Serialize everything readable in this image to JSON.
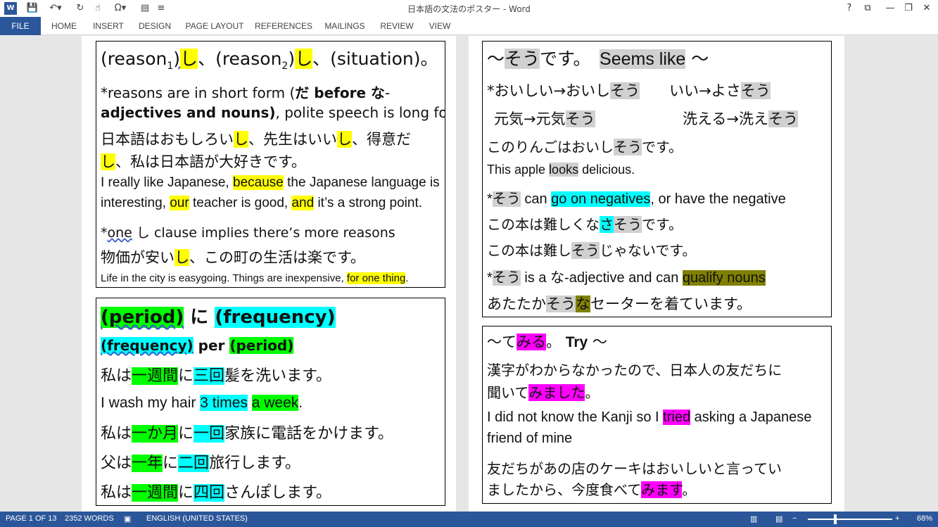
{
  "window": {
    "title": "日本語の文法のポスター - Word",
    "app_badge": "W",
    "controls": [
      "?",
      "⧉",
      "—",
      "❐",
      "✕"
    ]
  },
  "ribbon": {
    "tabs": [
      "FILE",
      "HOME",
      "INSERT",
      "DESIGN",
      "PAGE LAYOUT",
      "REFERENCES",
      "MAILINGS",
      "REVIEW",
      "VIEW"
    ]
  },
  "box1": {
    "l1": [
      "(reason",
      "1",
      ")",
      "し",
      "、(reason",
      "2",
      ")",
      "し",
      "、(situation)。"
    ],
    "l2": [
      "*reasons are in short form (",
      "だ before な",
      "-"
    ],
    "l3": [
      "adjectives and nouns)",
      ", polite speech is long form"
    ],
    "l4": [
      "日本語はおもしろい",
      "し",
      "、先生はいい",
      "し",
      "、得意だ"
    ],
    "l5": [
      "し",
      "、私は日本語が大好きです。"
    ],
    "l6": [
      "I really like Japanese, ",
      "because",
      " the Japanese language is"
    ],
    "l7": [
      "interesting, ",
      "our",
      " teacher is good, ",
      "and",
      " it’s a strong point."
    ],
    "l8": [
      "*",
      "one",
      " し clause implies there’s more reasons"
    ],
    "l9": [
      "物価が安い",
      "し",
      "、この町の生活は楽です。"
    ],
    "l10": [
      "Life in the city is easygoing. Things are inexpensive, ",
      "for one thing",
      "."
    ]
  },
  "box2": {
    "l1": [
      "(period)",
      " に ",
      "(frequency)"
    ],
    "l2": [
      "(frequency)",
      " per ",
      "(period)"
    ],
    "l3": [
      "私は",
      "一週間",
      "に",
      "三回",
      "髪を洗います。"
    ],
    "l4": [
      "I wash my hair ",
      "3 times",
      " ",
      "a week",
      "."
    ],
    "l5": [
      "私は",
      "一か月",
      "に",
      "一回",
      "家族に電話をかけます。"
    ],
    "l6": [
      "父は",
      "一年",
      "に",
      "二回",
      "旅行します。"
    ],
    "l7": [
      "私は",
      "一週間",
      "に",
      "四回",
      "さんぽします。"
    ]
  },
  "box3": {
    "l1": [
      "～",
      "そう",
      "です。　",
      "Seems like",
      " ～"
    ],
    "l2": [
      "*おいしい→おいし",
      "そう",
      "　　いい→よさ",
      "そう"
    ],
    "l3": [
      "元気→元気",
      "そう",
      "洗える→洗え",
      "そう"
    ],
    "l4": [
      "このりんごはおいし",
      "そう",
      "です。"
    ],
    "l5": [
      "This apple ",
      "looks",
      " delicious."
    ],
    "l6": [
      "*",
      "そう",
      " can ",
      "go on negatives",
      ", or have the negative"
    ],
    "l7": [
      "この本は難しくな",
      "さ",
      "そう",
      "です。"
    ],
    "l8": [
      "この本は難し",
      "そう",
      "じゃないです。"
    ],
    "l9": [
      "*",
      "そう",
      " is a な-adjective and can ",
      "qualify nouns"
    ],
    "l10": [
      "あたたか",
      "そう",
      "な",
      "セーターを着ています。"
    ]
  },
  "box4": {
    "l1": [
      "～て",
      "みる",
      "。 ",
      "Try",
      " ～"
    ],
    "l2": [
      "漢字がわからなかったので、日本人の友だちに"
    ],
    "l3": [
      "聞いて",
      "みました",
      "。"
    ],
    "l4": [
      "I did not know the Kanji so I ",
      "tried",
      " asking a Japanese"
    ],
    "l5": [
      "friend of mine"
    ],
    "l6": [
      "友だちがあの店のケーキはおいしいと言ってい"
    ],
    "l7": [
      "ましたから、今度食べて",
      "みます",
      "。"
    ]
  },
  "statusbar": {
    "page": "PAGE 1 OF 13",
    "words": "2352 WORDS",
    "language": "ENGLISH (UNITED STATES)",
    "zoom": "68%",
    "zoom_level": 0.68
  },
  "colors": {
    "accent": "#2b579a",
    "yellow": "#ffff00",
    "cyan": "#00ffff",
    "green": "#00ff00",
    "gray": "#d0d0d0",
    "olive": "#808000",
    "magenta": "#ff00ff"
  }
}
